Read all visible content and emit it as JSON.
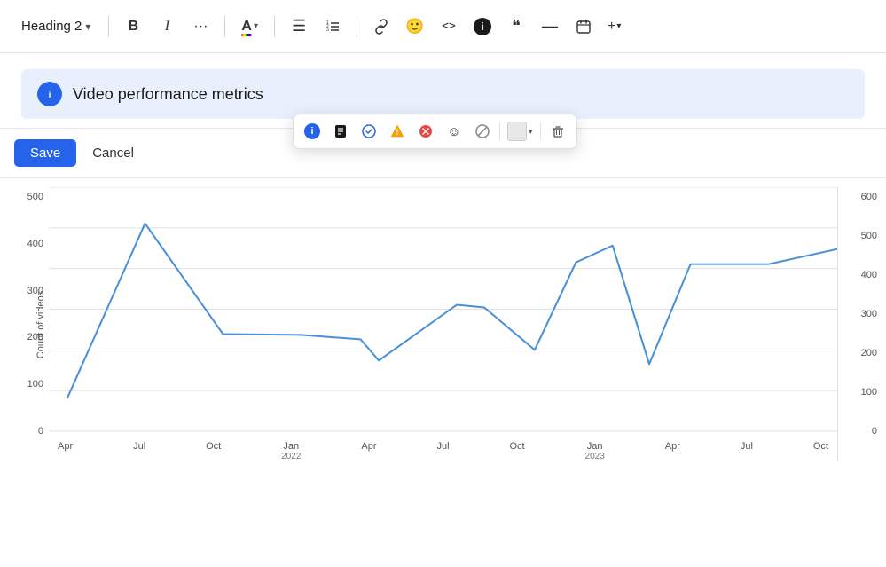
{
  "toolbar": {
    "heading_label": "Heading 2",
    "chevron": "▾",
    "bold_label": "B",
    "italic_label": "I",
    "more_label": "···",
    "color_icon": "A",
    "list_unordered": "≡",
    "list_ordered": "≣",
    "link_icon": "🔗",
    "emoji_icon": "🙂",
    "code_icon": "<>",
    "info_icon": "ℹ",
    "quote_icon": "❝",
    "dash_icon": "—",
    "calendar_icon": "📅",
    "plus_icon": "+"
  },
  "callout": {
    "text": "Video performance metrics"
  },
  "float_toolbar": {
    "icons": [
      "ℹ",
      "▣",
      "✔",
      "▲",
      "✖",
      "☺",
      "⊘"
    ]
  },
  "action_bar": {
    "save_label": "Save",
    "cancel_label": "Cancel"
  },
  "chart": {
    "y_title": "Count of videos",
    "y_labels": [
      "500",
      "400",
      "300",
      "200",
      "100",
      "0"
    ],
    "x_labels": [
      "Apr",
      "Jul",
      "Oct",
      "Jan",
      "Apr",
      "Jul",
      "Oct",
      "Jan",
      "Apr",
      "Jul",
      "Oct"
    ],
    "x_sublabels": [
      "",
      "",
      "",
      "2022",
      "",
      "",
      "",
      "2023",
      "",
      "",
      ""
    ],
    "right_y_labels": [
      "600",
      "500",
      "400",
      "300",
      "200",
      "100",
      "0"
    ]
  }
}
